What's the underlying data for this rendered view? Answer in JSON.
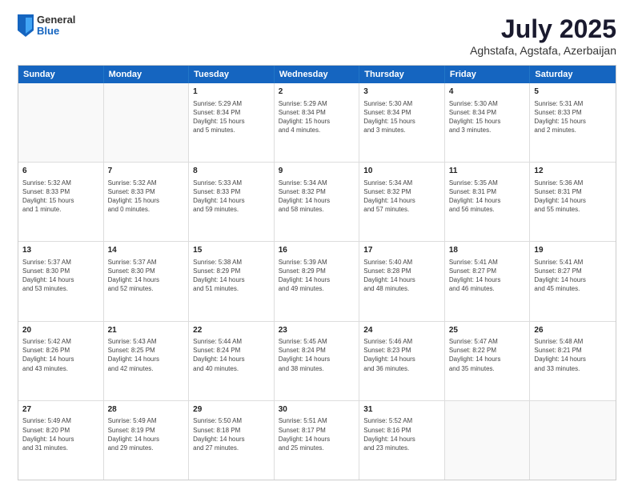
{
  "logo": {
    "general": "General",
    "blue": "Blue"
  },
  "title": "July 2025",
  "subtitle": "Aghstafa, Agstafa, Azerbaijan",
  "header_days": [
    "Sunday",
    "Monday",
    "Tuesday",
    "Wednesday",
    "Thursday",
    "Friday",
    "Saturday"
  ],
  "weeks": [
    {
      "days": [
        {
          "num": "",
          "info": ""
        },
        {
          "num": "",
          "info": ""
        },
        {
          "num": "1",
          "info": "Sunrise: 5:29 AM\nSunset: 8:34 PM\nDaylight: 15 hours\nand 5 minutes."
        },
        {
          "num": "2",
          "info": "Sunrise: 5:29 AM\nSunset: 8:34 PM\nDaylight: 15 hours\nand 4 minutes."
        },
        {
          "num": "3",
          "info": "Sunrise: 5:30 AM\nSunset: 8:34 PM\nDaylight: 15 hours\nand 3 minutes."
        },
        {
          "num": "4",
          "info": "Sunrise: 5:30 AM\nSunset: 8:34 PM\nDaylight: 15 hours\nand 3 minutes."
        },
        {
          "num": "5",
          "info": "Sunrise: 5:31 AM\nSunset: 8:33 PM\nDaylight: 15 hours\nand 2 minutes."
        }
      ]
    },
    {
      "days": [
        {
          "num": "6",
          "info": "Sunrise: 5:32 AM\nSunset: 8:33 PM\nDaylight: 15 hours\nand 1 minute."
        },
        {
          "num": "7",
          "info": "Sunrise: 5:32 AM\nSunset: 8:33 PM\nDaylight: 15 hours\nand 0 minutes."
        },
        {
          "num": "8",
          "info": "Sunrise: 5:33 AM\nSunset: 8:33 PM\nDaylight: 14 hours\nand 59 minutes."
        },
        {
          "num": "9",
          "info": "Sunrise: 5:34 AM\nSunset: 8:32 PM\nDaylight: 14 hours\nand 58 minutes."
        },
        {
          "num": "10",
          "info": "Sunrise: 5:34 AM\nSunset: 8:32 PM\nDaylight: 14 hours\nand 57 minutes."
        },
        {
          "num": "11",
          "info": "Sunrise: 5:35 AM\nSunset: 8:31 PM\nDaylight: 14 hours\nand 56 minutes."
        },
        {
          "num": "12",
          "info": "Sunrise: 5:36 AM\nSunset: 8:31 PM\nDaylight: 14 hours\nand 55 minutes."
        }
      ]
    },
    {
      "days": [
        {
          "num": "13",
          "info": "Sunrise: 5:37 AM\nSunset: 8:30 PM\nDaylight: 14 hours\nand 53 minutes."
        },
        {
          "num": "14",
          "info": "Sunrise: 5:37 AM\nSunset: 8:30 PM\nDaylight: 14 hours\nand 52 minutes."
        },
        {
          "num": "15",
          "info": "Sunrise: 5:38 AM\nSunset: 8:29 PM\nDaylight: 14 hours\nand 51 minutes."
        },
        {
          "num": "16",
          "info": "Sunrise: 5:39 AM\nSunset: 8:29 PM\nDaylight: 14 hours\nand 49 minutes."
        },
        {
          "num": "17",
          "info": "Sunrise: 5:40 AM\nSunset: 8:28 PM\nDaylight: 14 hours\nand 48 minutes."
        },
        {
          "num": "18",
          "info": "Sunrise: 5:41 AM\nSunset: 8:27 PM\nDaylight: 14 hours\nand 46 minutes."
        },
        {
          "num": "19",
          "info": "Sunrise: 5:41 AM\nSunset: 8:27 PM\nDaylight: 14 hours\nand 45 minutes."
        }
      ]
    },
    {
      "days": [
        {
          "num": "20",
          "info": "Sunrise: 5:42 AM\nSunset: 8:26 PM\nDaylight: 14 hours\nand 43 minutes."
        },
        {
          "num": "21",
          "info": "Sunrise: 5:43 AM\nSunset: 8:25 PM\nDaylight: 14 hours\nand 42 minutes."
        },
        {
          "num": "22",
          "info": "Sunrise: 5:44 AM\nSunset: 8:24 PM\nDaylight: 14 hours\nand 40 minutes."
        },
        {
          "num": "23",
          "info": "Sunrise: 5:45 AM\nSunset: 8:24 PM\nDaylight: 14 hours\nand 38 minutes."
        },
        {
          "num": "24",
          "info": "Sunrise: 5:46 AM\nSunset: 8:23 PM\nDaylight: 14 hours\nand 36 minutes."
        },
        {
          "num": "25",
          "info": "Sunrise: 5:47 AM\nSunset: 8:22 PM\nDaylight: 14 hours\nand 35 minutes."
        },
        {
          "num": "26",
          "info": "Sunrise: 5:48 AM\nSunset: 8:21 PM\nDaylight: 14 hours\nand 33 minutes."
        }
      ]
    },
    {
      "days": [
        {
          "num": "27",
          "info": "Sunrise: 5:49 AM\nSunset: 8:20 PM\nDaylight: 14 hours\nand 31 minutes."
        },
        {
          "num": "28",
          "info": "Sunrise: 5:49 AM\nSunset: 8:19 PM\nDaylight: 14 hours\nand 29 minutes."
        },
        {
          "num": "29",
          "info": "Sunrise: 5:50 AM\nSunset: 8:18 PM\nDaylight: 14 hours\nand 27 minutes."
        },
        {
          "num": "30",
          "info": "Sunrise: 5:51 AM\nSunset: 8:17 PM\nDaylight: 14 hours\nand 25 minutes."
        },
        {
          "num": "31",
          "info": "Sunrise: 5:52 AM\nSunset: 8:16 PM\nDaylight: 14 hours\nand 23 minutes."
        },
        {
          "num": "",
          "info": ""
        },
        {
          "num": "",
          "info": ""
        }
      ]
    }
  ]
}
